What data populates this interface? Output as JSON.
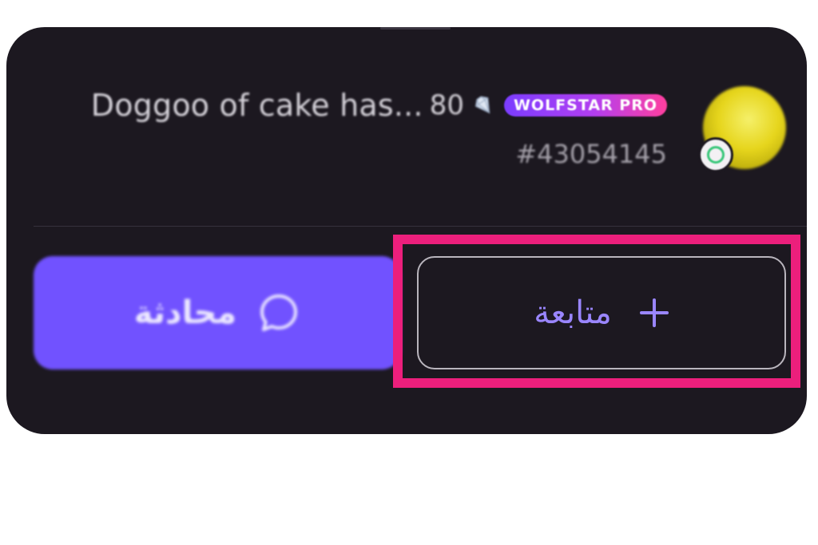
{
  "profile": {
    "name": "Doggoo of cake has...",
    "diamond_count": "80",
    "diamond_icon": "diamond-icon",
    "badge_label": "WOLFSTAR PRO",
    "user_id": "#43054145",
    "avatar_icon": "avatar",
    "status_icon": "online-status-icon"
  },
  "actions": {
    "chat_label": "محادثة",
    "chat_icon": "chat-bubble-icon",
    "follow_label": "متابعة",
    "follow_icon": "plus-icon"
  },
  "colors": {
    "card_background": "#1c1820",
    "chat_button": "#7152ff",
    "follow_text": "#9a86ff",
    "highlight": "#ec1f7c",
    "badge_gradient_start": "#7b3dff",
    "badge_gradient_end": "#ff3f9e"
  }
}
